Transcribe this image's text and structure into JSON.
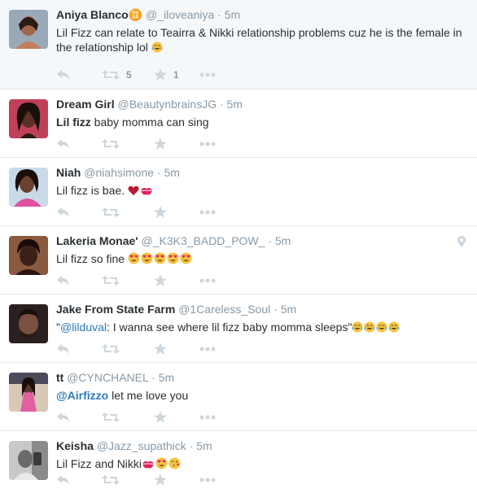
{
  "tweets": [
    {
      "name": "Aniya Blanco♊",
      "handle": "@_iloveaniya",
      "time": "5m",
      "text": "Lil Fizz can relate to Teairra & Nikki relationship problems cuz he is the female in the relationship lol",
      "emojis": [
        "joy"
      ],
      "retweets": "5",
      "favorites": "1",
      "avatar_color": "#a0684a",
      "avatar_bg": "#9aa9b8"
    },
    {
      "name": "Dream Girl",
      "handle": "@BeautynbrainsJG",
      "time": "5m",
      "text_bold": "Lil fizz",
      "text": " baby momma can sing",
      "avatar_color": "#5a3024",
      "avatar_bg": "#c0405a"
    },
    {
      "name": "Niah",
      "handle": "@niahsimone",
      "time": "5m",
      "text": "Lil fizz is bae.",
      "emojis": [
        "heart",
        "kiss"
      ],
      "avatar_color": "#6a4030",
      "avatar_bg": "#c8dae8"
    },
    {
      "name": "Lakeria Monae'",
      "handle": "@_K3K3_BADD_POW_",
      "time": "5m",
      "text": "Lil fizz so fine",
      "emojis": [
        "heart-eyes",
        "heart-eyes",
        "heart-eyes",
        "heart-eyes",
        "heart-eyes"
      ],
      "avatar_color": "#3a2018",
      "avatar_bg": "#8a5a40",
      "has_location": true
    },
    {
      "name": "Jake From State Farm",
      "handle": "@1Careless_Soul",
      "time": "5m",
      "text_prefix": "\"",
      "mention": "@lilduval",
      "text": ": I wanna see where lil fizz baby momma sleeps\"",
      "emojis": [
        "joy",
        "joy",
        "joy",
        "joy"
      ],
      "avatar_color": "#7a5040",
      "avatar_bg": "#2a2020"
    },
    {
      "name": "tt",
      "handle": "@CYNCHANEL",
      "time": "5m",
      "mention_bold": "@Airfizzo",
      "text": " let me love you",
      "avatar_color": "#5a3a30",
      "avatar_bg": "#d8c8b8"
    },
    {
      "name": "Keisha",
      "handle": "@Jazz_supathick",
      "time": "5m",
      "text": "Lil Fizz and Nikki",
      "emojis": [
        "kiss",
        "heart-eyes",
        "kiss-heart"
      ],
      "avatar_color": "#6a6a6a",
      "avatar_bg": "#c8c8c8"
    }
  ]
}
